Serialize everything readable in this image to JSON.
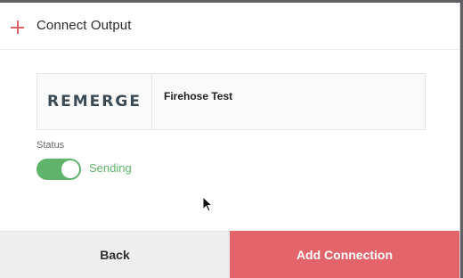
{
  "header": {
    "title": "Connect Output",
    "icon": "plus-icon"
  },
  "output_card": {
    "logo_text": "REMERGE",
    "name": "Firehose Test"
  },
  "status": {
    "label": "Status",
    "toggle_on": true,
    "toggle_text": "Sending"
  },
  "footer": {
    "back_label": "Back",
    "add_label": "Add Connection"
  },
  "colors": {
    "accent": "#e3646a",
    "success": "#5fb36a"
  }
}
